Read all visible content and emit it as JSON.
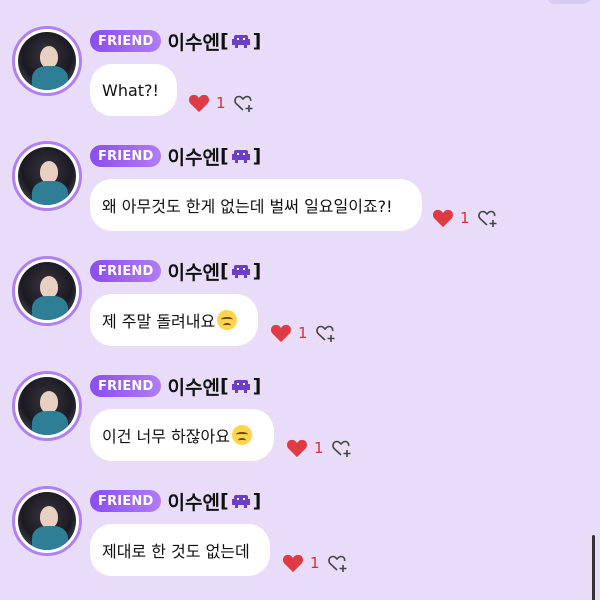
{
  "messages": [
    {
      "badge": "FRIEND",
      "nickname": "이수엔",
      "text": "What?!",
      "reaction_count": "1",
      "emoji": null
    },
    {
      "badge": "FRIEND",
      "nickname": "이수엔",
      "text": "왜 아무것도 한게 없는데 벌써 일요일이죠?!",
      "reaction_count": "1",
      "emoji": null
    },
    {
      "badge": "FRIEND",
      "nickname": "이수엔",
      "text": "제 주말 돌려내요",
      "reaction_count": "1",
      "emoji": "crying-face"
    },
    {
      "badge": "FRIEND",
      "nickname": "이수엔",
      "text": "이건 너무 하잖아요",
      "reaction_count": "1",
      "emoji": "sad-face"
    },
    {
      "badge": "FRIEND",
      "nickname": "이수엔",
      "text": "제대로 한 것도 없는데",
      "reaction_count": "1",
      "emoji": null
    }
  ],
  "bracket_open": "[",
  "bracket_close": "]",
  "icons": {
    "like": "heart-icon",
    "add_reaction": "add-reaction-icon",
    "nick_emoji": "space-invader-icon"
  },
  "colors": {
    "background": "#e8dcf8",
    "badge_gradient_start": "#8a4df0",
    "badge_gradient_end": "#b17cf6",
    "heart": "#d8303a"
  }
}
